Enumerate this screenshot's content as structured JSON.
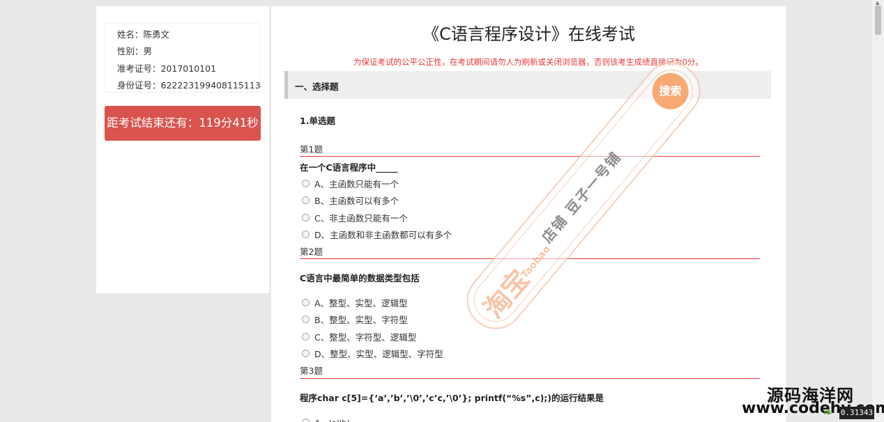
{
  "student": {
    "name": "姓名：陈勇文",
    "gender": "性别：男",
    "ticket": "准考证号：2017010101",
    "id_card": "身份证号：622223199408115113"
  },
  "timer": "距考试结束还有：119分41秒",
  "exam": {
    "title": "《C语言程序设计》在线考试",
    "notice": "为保证考试的公平公正性，在考试期间请勿人为刷新或关闭浏览器，否则该考生成绩直接记为0分。",
    "section": "一、选择题",
    "qtype": "1.单选题",
    "questions": [
      {
        "num": "第1题",
        "stem": "在一个C语言程序中_____",
        "options": [
          "A、主函数只能有一个",
          "B、主函数可以有多个",
          "C、非主函数只能有一个",
          "D、主函数和非主函数都可以有多个"
        ]
      },
      {
        "num": "第2题",
        "stem": "C语言中最简单的数据类型包括",
        "options": [
          "A、整型、实型、逻辑型",
          "B、整型、实型、字符型",
          "C、整型、字符型、逻辑型",
          "D、整型、实型、逻辑型、字符型"
        ]
      },
      {
        "num": "第3题",
        "stem": "程序char c[5]={‘a’,’b’,’\\0’,’c’c,’\\0’}; printf(“%s”,c);)的运行结果是",
        "options": [
          "A、'a''b'"
        ]
      }
    ]
  },
  "watermark": {
    "logo": "淘宝",
    "logo_en": "Taobao",
    "shop": "店铺  豆子一号铺",
    "search": "搜索"
  },
  "branding": {
    "site_cn": "源码海洋网",
    "site_url": "www.codehy.com",
    "corner_tag": "0.31343"
  },
  "icons": {
    "radio": "radio-button-icon",
    "scroll_up": "scroll-up-arrow-icon",
    "leaf": "leaf-icon"
  }
}
